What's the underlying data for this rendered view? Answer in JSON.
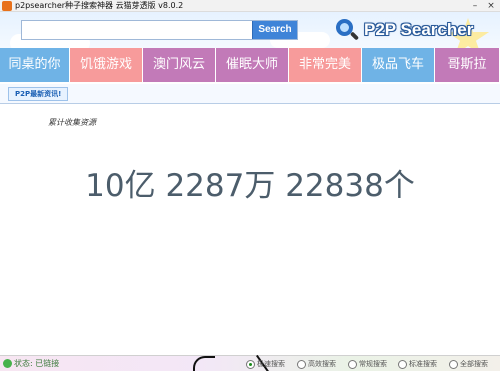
{
  "window": {
    "title": "p2psearcher种子搜索神器  云猫芽透版 v8.0.2",
    "min_glyph": "–",
    "close_glyph": "×"
  },
  "header": {
    "search_placeholder": "",
    "search_button": "Search",
    "logo_text": "P2P Searcher",
    "logo_icon": "magnifier-icon"
  },
  "tabs": [
    {
      "label": "同桌的你",
      "color": "#6fb3e6"
    },
    {
      "label": "饥饿游戏",
      "color": "#f79b9b"
    },
    {
      "label": "澳门风云",
      "color": "#c27ab8"
    },
    {
      "label": "催眠大师",
      "color": "#c27ab8"
    },
    {
      "label": "非常完美",
      "color": "#f79b9b"
    },
    {
      "label": "极品飞车",
      "color": "#6fb3e6"
    },
    {
      "label": "哥斯拉",
      "color": "#c27ab8"
    }
  ],
  "news": {
    "tag": "P2P最新资讯!"
  },
  "main": {
    "collect_label": "累计收集资源",
    "count": "10亿 2287万 22838个"
  },
  "status": {
    "text": "状态: 已链接",
    "icon": "connected-icon",
    "search_modes": [
      {
        "label": "极速搜索",
        "selected": true
      },
      {
        "label": "高效搜索",
        "selected": false
      },
      {
        "label": "常规搜索",
        "selected": false
      },
      {
        "label": "标准搜索",
        "selected": false
      },
      {
        "label": "全部搜索",
        "selected": false
      }
    ]
  }
}
